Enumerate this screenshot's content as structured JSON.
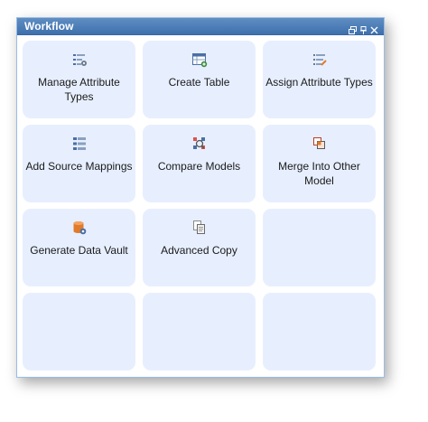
{
  "window": {
    "title": "Workflow",
    "tools": [
      "restore-icon",
      "pin-icon",
      "close-icon"
    ]
  },
  "tiles": [
    {
      "label": "Manage Attribute Types",
      "icon": "attribute-settings-icon"
    },
    {
      "label": "Create Table",
      "icon": "create-table-icon"
    },
    {
      "label": "Assign Attribute Types",
      "icon": "assign-attribute-icon"
    },
    {
      "label": "Add Source Mappings",
      "icon": "source-mapping-icon"
    },
    {
      "label": "Compare Models",
      "icon": "compare-models-icon"
    },
    {
      "label": "Merge Into Other Model",
      "icon": "merge-model-icon"
    },
    {
      "label": "Generate Data Vault",
      "icon": "data-vault-icon"
    },
    {
      "label": "Advanced Copy",
      "icon": "copy-icon"
    }
  ],
  "colors": {
    "titlebar": "#4a7bb7",
    "tile_background": "#e7efff",
    "border": "#99bce8"
  }
}
